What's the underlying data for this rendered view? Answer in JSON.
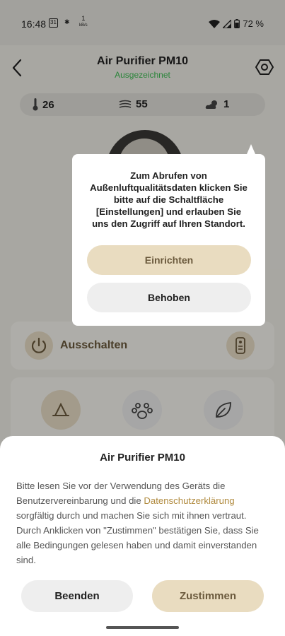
{
  "status_bar": {
    "time": "16:48",
    "calendar_day": "31",
    "net_speed": "1",
    "net_unit": "kB/s",
    "battery": "72 %"
  },
  "header": {
    "title": "Air Purifier PM10",
    "subtitle": "Ausgezeichnet",
    "subtitle_color": "#3fbf55"
  },
  "env": {
    "temperature": "26",
    "humidity": "55",
    "weather": "1"
  },
  "device": {
    "power_label": "Ausschalten"
  },
  "popup": {
    "message": "Zum Abrufen von Außenluftqualitätsdaten klicken Sie bitte auf die Schaltfläche [Einstellungen] und erlauben Sie uns den Zugriff auf Ihren Standort.",
    "setup_label": "Einrichten",
    "fixed_label": "Behoben"
  },
  "sheet": {
    "title": "Air Purifier PM10",
    "body_before_link": "Bitte lesen Sie vor der Verwendung des Geräts die Benutzervereinbarung und die ",
    "link_text": "Datenschutzerklärung",
    "body_after_link": " sorgfältig durch und machen Sie sich mit ihnen vertraut. Durch Anklicken von \"Zustimmen\" bestätigen Sie, dass Sie alle Bedingungen gelesen haben und damit einverstanden sind.",
    "quit_label": "Beenden",
    "agree_label": "Zustimmen"
  },
  "colors": {
    "accent": "#e9dcc0",
    "accent_text": "#6b5a3d",
    "link": "#b08a3e"
  }
}
